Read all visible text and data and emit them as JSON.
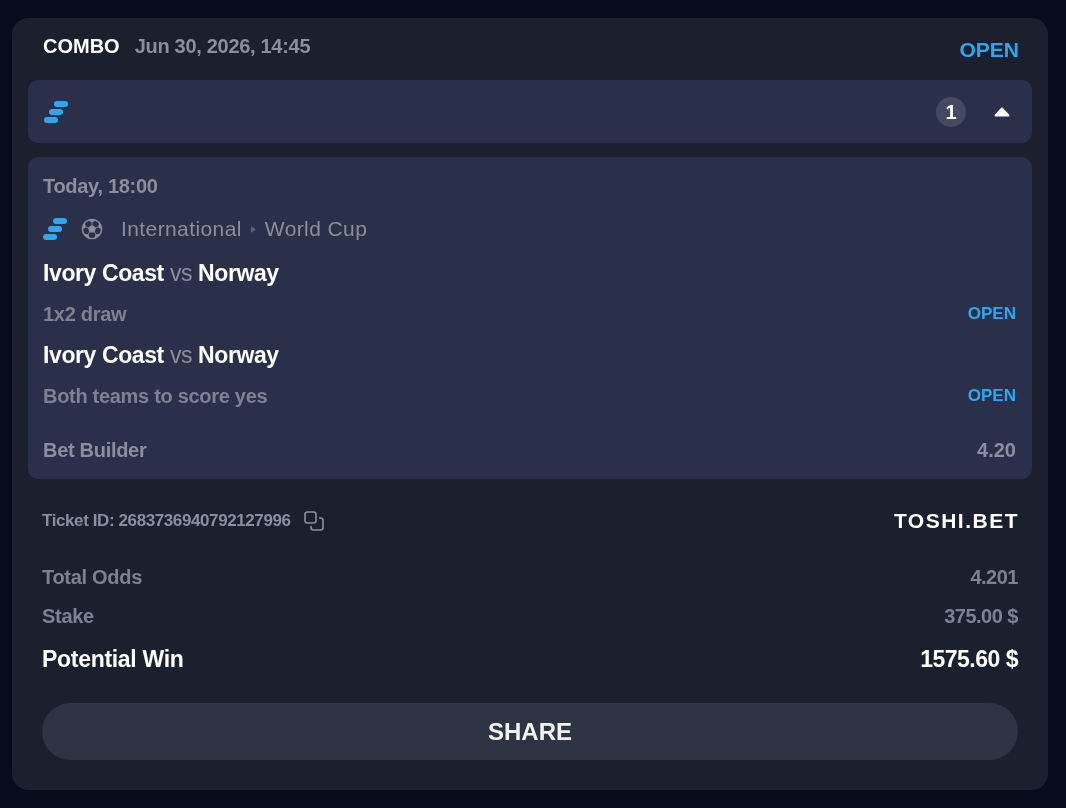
{
  "header": {
    "type": "COMBO",
    "date": "Jun 30, 2026, 14:45",
    "status": "OPEN"
  },
  "group": {
    "count": "1",
    "expanded": true
  },
  "selection": {
    "time": "Today, 18:00",
    "breadcrumb": [
      "International",
      "World Cup"
    ],
    "legs": [
      {
        "home": "Ivory Coast",
        "vs": "vs",
        "away": "Norway",
        "market": "1x2 draw",
        "status": "OPEN"
      },
      {
        "home": "Ivory Coast",
        "vs": "vs",
        "away": "Norway",
        "market": "Both teams to score yes",
        "status": "OPEN"
      }
    ],
    "builder": {
      "label": "Bet Builder",
      "odds": "4.20"
    }
  },
  "ticket": {
    "id": "Ticket ID: 2683736940792127996",
    "brand": "TOSHI.BET"
  },
  "summary": [
    {
      "label": "Total Odds",
      "value": "4.201",
      "kind": "muted"
    },
    {
      "label": "Stake",
      "value": "375.00 $",
      "kind": "muted"
    },
    {
      "label": "Potential Win",
      "value": "1575.60 $",
      "kind": "total"
    }
  ],
  "share_button": "SHARE"
}
